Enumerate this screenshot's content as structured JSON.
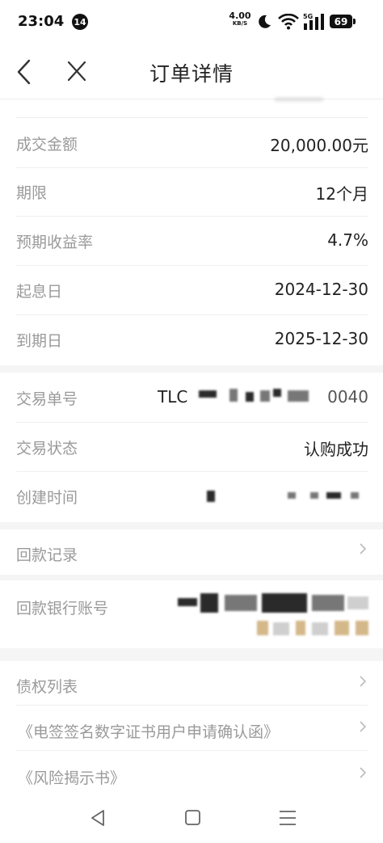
{
  "status_bar": {
    "time": "23:04",
    "notification_count": "14",
    "net_speed": "4.00",
    "net_speed_unit": "KB/S",
    "network_label": "5G",
    "battery": "69"
  },
  "header": {
    "title": "订单详情"
  },
  "order_info": [
    {
      "label": "成交金额",
      "value": "20,000.00元"
    },
    {
      "label": "期限",
      "value": "12个月"
    },
    {
      "label": "预期收益率",
      "value": "4.7%"
    },
    {
      "label": "起息日",
      "value": "2024-12-30"
    },
    {
      "label": "到期日",
      "value": "2025-12-30"
    }
  ],
  "transaction": {
    "number_label": "交易单号",
    "number_prefix": "TLC",
    "number_suffix": "0040",
    "status_label": "交易状态",
    "status_value": "认购成功",
    "created_label": "创建时间"
  },
  "repayment_record": {
    "label": "回款记录"
  },
  "bank_account": {
    "label": "回款银行账号"
  },
  "documents": [
    {
      "label": "债权列表"
    },
    {
      "label": "《电签签名数字证书用户申请确认函》"
    },
    {
      "label": "《风险揭示书》"
    }
  ]
}
